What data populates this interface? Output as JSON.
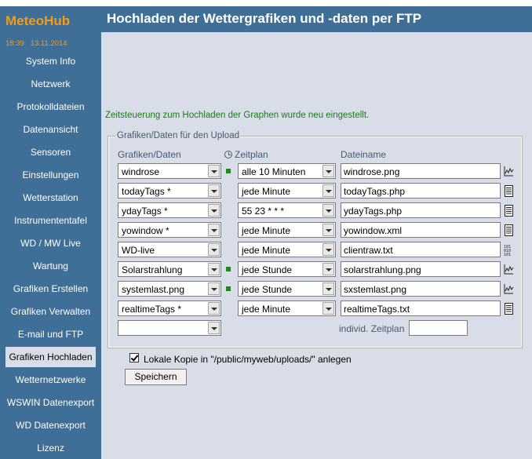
{
  "app": {
    "name": "MeteoHub",
    "time": "18:39",
    "date": "13.11.2014"
  },
  "sidebar": {
    "items": [
      {
        "label": "System Info"
      },
      {
        "label": "Netzwerk"
      },
      {
        "label": "Protokolldateien"
      },
      {
        "label": "Datenansicht"
      },
      {
        "label": "Sensoren"
      },
      {
        "label": "Einstellungen"
      },
      {
        "label": "Wetterstation"
      },
      {
        "label": "Instrumententafel"
      },
      {
        "label": "WD / MW Live"
      },
      {
        "label": "Wartung"
      },
      {
        "label": "Grafiken Erstellen"
      },
      {
        "label": "Grafiken Verwalten"
      },
      {
        "label": "E-mail und FTP"
      },
      {
        "label": "Grafiken Hochladen",
        "active": true
      },
      {
        "label": "Wetternetzwerke"
      },
      {
        "label": "WSWIN Datenexport"
      },
      {
        "label": "WD Datenexport"
      },
      {
        "label": "Lizenz"
      }
    ]
  },
  "header": {
    "title": "Hochladen der Wettergrafiken und -daten per FTP"
  },
  "main": {
    "message": "Zeitsteuerung zum Hochladen der Graphen wurde neu eingestellt.",
    "fieldset": {
      "legend": "Grafiken/Daten für den Upload",
      "col_data": "Grafiken/Daten",
      "col_schedule": "Zeitplan",
      "col_filename": "Dateiname"
    },
    "rows": [
      {
        "data": "windrose",
        "schedule": "alle 10 Minuten",
        "filename": "windrose.png",
        "indicator": true,
        "icon": "graph-icon"
      },
      {
        "data": "todayTags *",
        "schedule": "jede Minute",
        "filename": "todayTags.php",
        "indicator": false,
        "icon": "document-icon"
      },
      {
        "data": "ydayTags *",
        "schedule": "55 23 * * *",
        "filename": "ydayTags.php",
        "indicator": false,
        "icon": "document-icon"
      },
      {
        "data": "yowindow *",
        "schedule": "jede Minute",
        "filename": "yowindow.xml",
        "indicator": false,
        "icon": "document-icon"
      },
      {
        "data": "WD-live",
        "schedule": "jede Minute",
        "filename": "clientraw.txt",
        "indicator": false,
        "icon": "binary-icon"
      },
      {
        "data": "Solarstrahlung",
        "schedule": "jede Stunde",
        "filename": "solarstrahlung.png",
        "indicator": true,
        "icon": "graph-icon"
      },
      {
        "data": "systemlast.png",
        "schedule": "jede Stunde",
        "filename": "sxstemlast.png",
        "indicator": true,
        "icon": "graph-icon"
      },
      {
        "data": "realtimeTags *",
        "schedule": "jede Minute",
        "filename": "realtimeTags.txt",
        "indicator": false,
        "icon": "document-icon"
      }
    ],
    "empty_row": {
      "data": "",
      "individual_label": "individ. Zeitplan",
      "individual_value": ""
    },
    "local_copy": {
      "checked": true,
      "label": "Lokale Kopie in \"/public/myweb/uploads/\" anlegen"
    },
    "save_label": "Speichern"
  },
  "colors": {
    "sidebar": "#3f6e96",
    "content": "#d8dde7",
    "brand": "#f39c12",
    "message": "#1d7a1d",
    "indicator": "#1f8a1f"
  }
}
